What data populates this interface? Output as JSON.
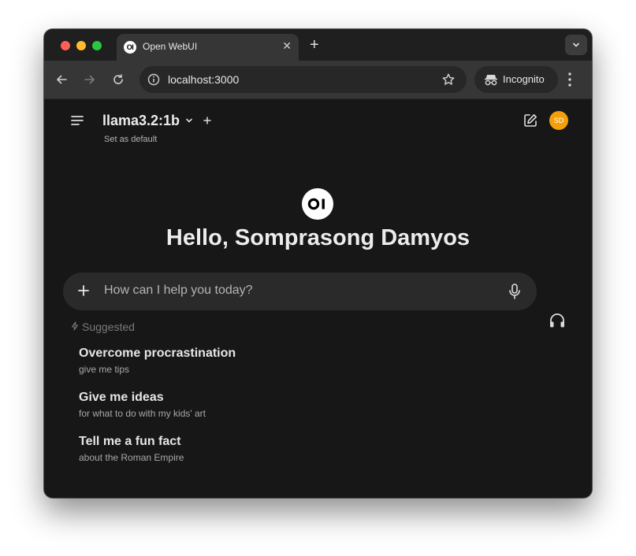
{
  "browser": {
    "tab_title": "Open WebUI",
    "tab_favicon_text": "OI",
    "url": "localhost:3000",
    "incognito_label": "Incognito"
  },
  "header": {
    "model_name": "llama3.2:1b",
    "set_default_label": "Set as default",
    "avatar_initials": "SD",
    "avatar_color": "#f59e0b"
  },
  "main": {
    "logo_text": "OI",
    "greeting": "Hello, Somprasong Damyos",
    "input_placeholder": "How can I help you today?",
    "suggested_label": "Suggested",
    "suggestions": [
      {
        "title": "Overcome procrastination",
        "subtitle": "give me tips"
      },
      {
        "title": "Give me ideas",
        "subtitle": "for what to do with my kids' art"
      },
      {
        "title": "Tell me a fun fact",
        "subtitle": "about the Roman Empire"
      }
    ]
  }
}
